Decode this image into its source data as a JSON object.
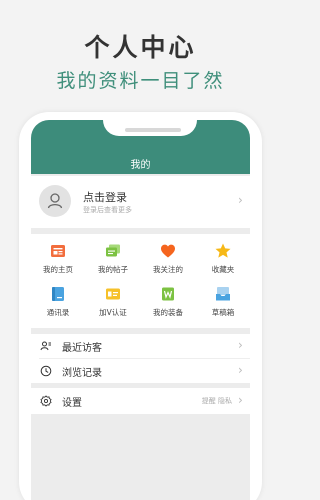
{
  "promo": {
    "title": "个人中心",
    "subtitle": "我的资料一目了然"
  },
  "header": {
    "title": "我的"
  },
  "login": {
    "title": "点击登录",
    "subtitle": "登录后查看更多"
  },
  "grid": {
    "items": [
      {
        "label": "我的主页",
        "icon": "homepage-icon",
        "color": "#f26d3d"
      },
      {
        "label": "我的帖子",
        "icon": "posts-icon",
        "color": "#7cc242"
      },
      {
        "label": "我关注的",
        "icon": "heart-icon",
        "color": "#f5651e"
      },
      {
        "label": "收藏夹",
        "icon": "star-icon",
        "color": "#f6b817"
      },
      {
        "label": "通讯录",
        "icon": "contacts-icon",
        "color": "#4aa3e0"
      },
      {
        "label": "加V认证",
        "icon": "verify-icon",
        "color": "#f6c12a"
      },
      {
        "label": "我的装备",
        "icon": "equipment-icon",
        "color": "#7cc242"
      },
      {
        "label": "草稿箱",
        "icon": "drafts-icon",
        "color": "#4aa3e0"
      }
    ]
  },
  "menu": {
    "recent_visitors": "最近访客",
    "history": "浏览记录",
    "settings": "设置",
    "settings_extra": "提醒 隐私"
  },
  "colors": {
    "accent": "#3d8c7b",
    "background": "#f3f3f3"
  }
}
